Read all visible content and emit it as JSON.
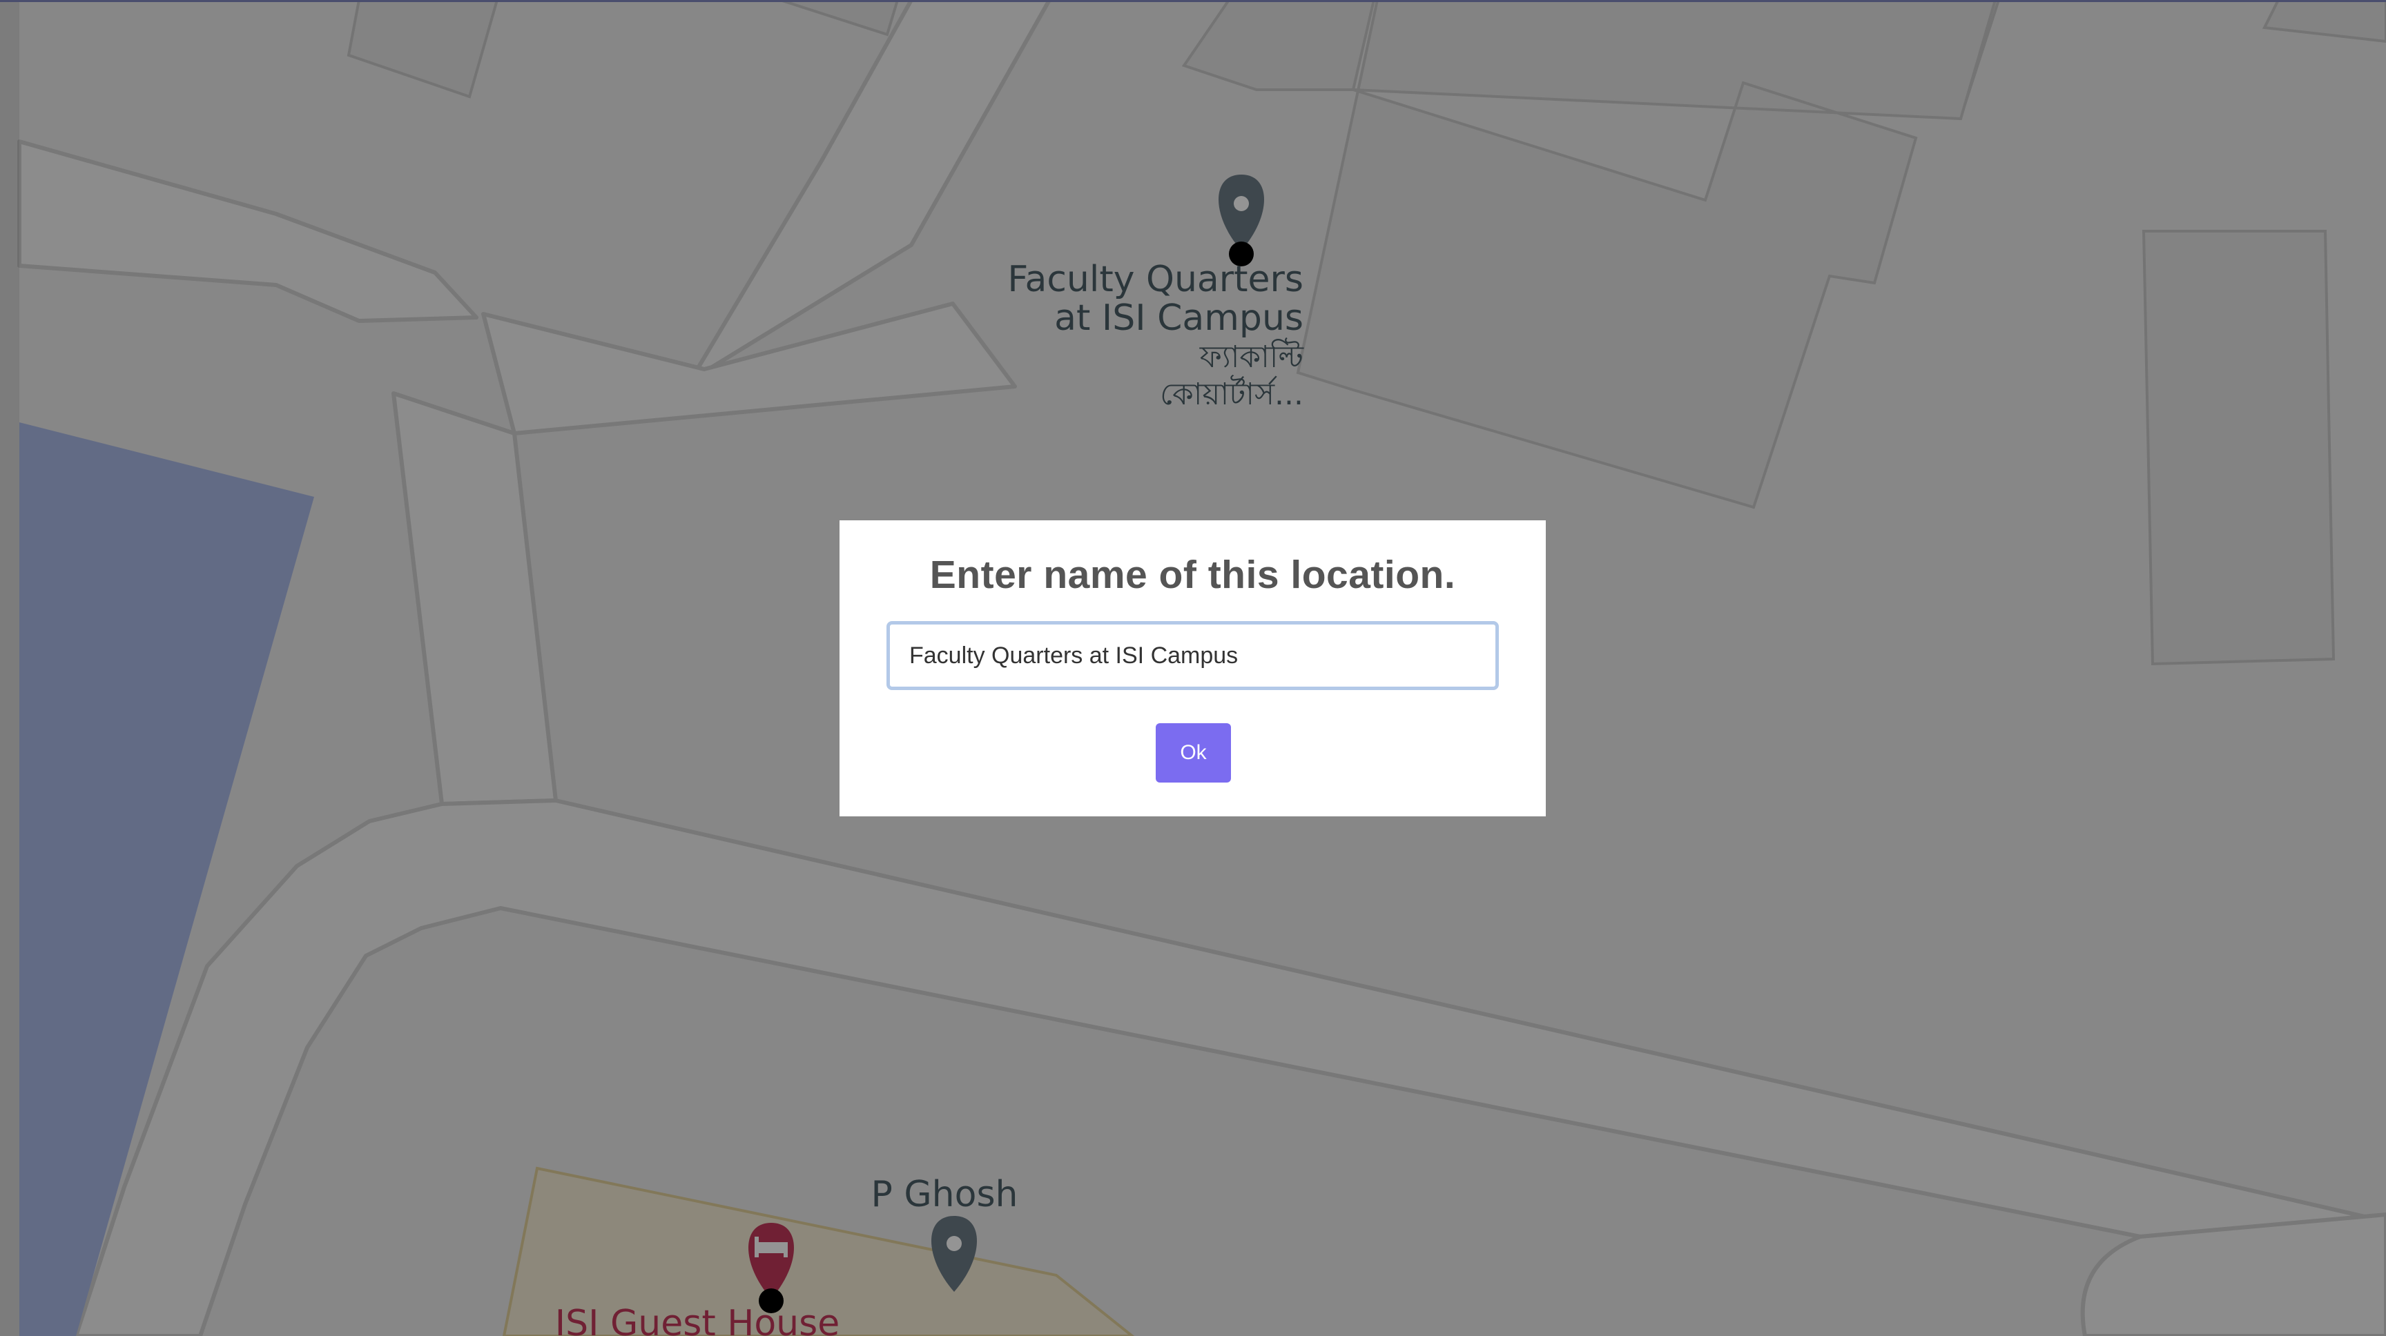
{
  "dialog": {
    "title": "Enter name of this location.",
    "input_value": "Faculty Quarters at ISI Campus",
    "ok_label": "Ok"
  },
  "map": {
    "labels": {
      "faculty_line1": "Faculty Quarters",
      "faculty_line2": "at ISI Campus",
      "faculty_bengali1": "ফ্যাকাল্টি",
      "faculty_bengali2": "কোয়ার্টার্স...",
      "pghosh": "P Ghosh",
      "guest_house": "ISI Guest House"
    },
    "icons": [
      "map-pin-icon",
      "hotel-bed-icon"
    ]
  },
  "colors": {
    "map_background": "#e8e8e8",
    "road_fill": "#f1f1f1",
    "road_outline": "#cfcfcf",
    "water": "#aab9e6",
    "guest_house_area": "#f3ead5",
    "pin_gray": "#6c7a85",
    "pin_hotel": "#c1385a",
    "overlay": "rgba(0,0,0,0.42)",
    "button": "#7b6cf0",
    "input_border": "#b3c9e8"
  }
}
